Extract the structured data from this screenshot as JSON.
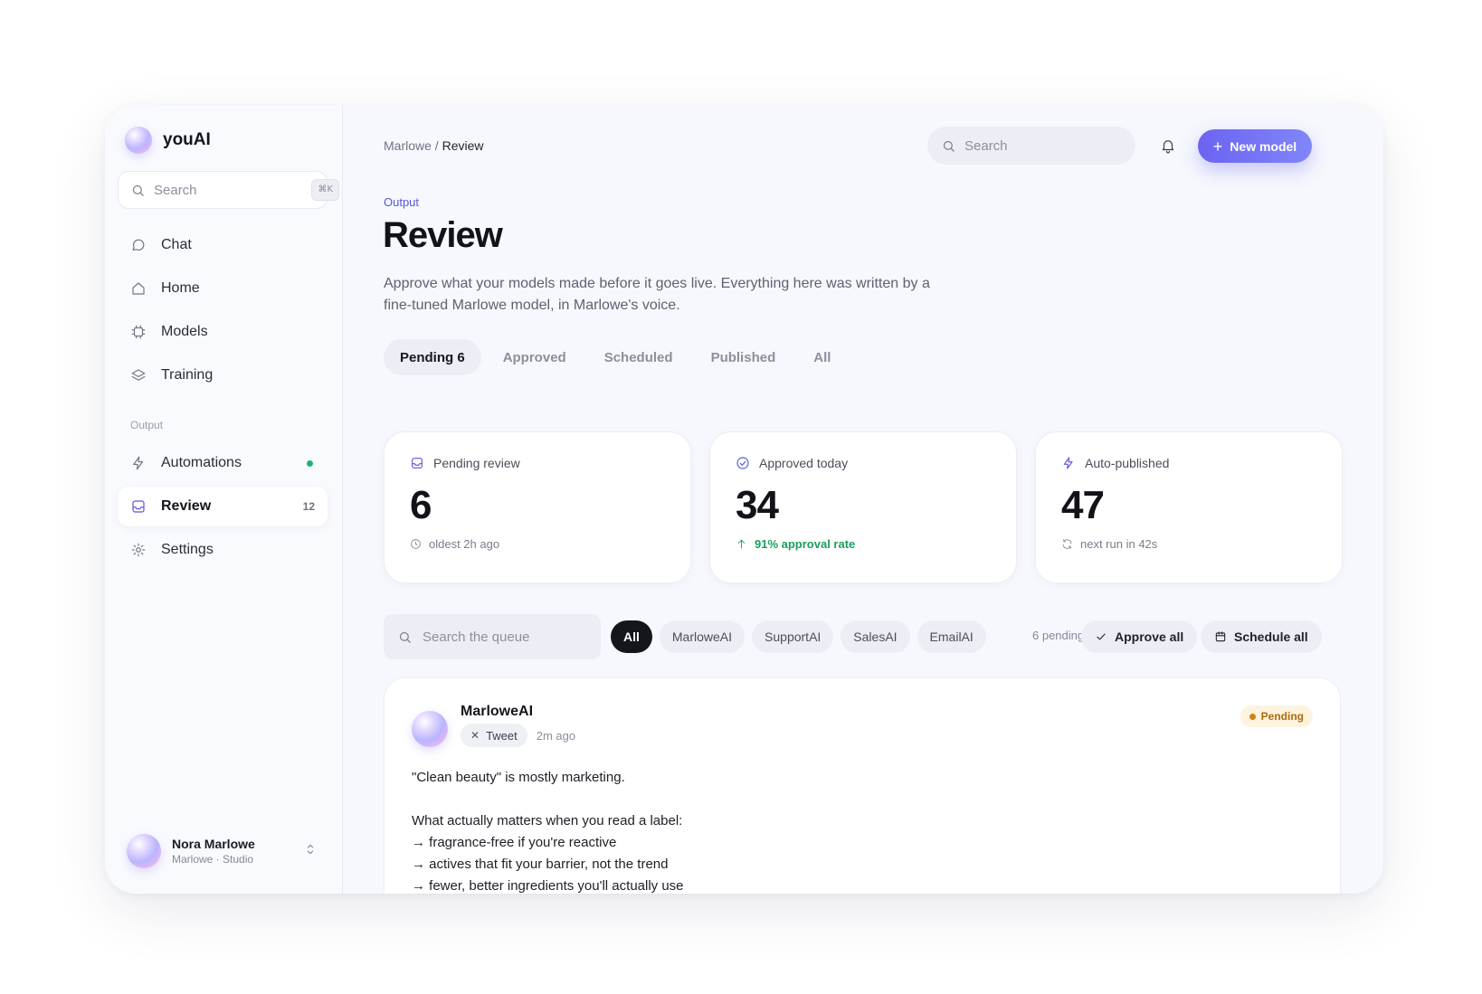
{
  "brand": {
    "name": "youAI"
  },
  "sidebar": {
    "search_placeholder": "Search",
    "shortcut": "⌘K",
    "items": [
      {
        "label": "Chat",
        "icon": "chat-bubble-icon"
      },
      {
        "label": "Home",
        "icon": "home-icon"
      },
      {
        "label": "Models",
        "icon": "chip-icon"
      },
      {
        "label": "Training",
        "icon": "layers-icon"
      }
    ],
    "section_label": "Output",
    "output_items": [
      {
        "label": "Automations",
        "icon": "bolt-icon",
        "status_color": "#1fb56f"
      },
      {
        "label": "Review",
        "icon": "inbox-icon",
        "badge": "12",
        "active": true
      },
      {
        "label": "Settings",
        "icon": "gear-icon"
      }
    ],
    "user": {
      "name": "Nora Marlowe",
      "subtitle": "Marlowe · Studio"
    }
  },
  "header": {
    "breadcrumb_parent": "Marlowe",
    "breadcrumb_sep": "/",
    "breadcrumb_current": "Review",
    "search_placeholder": "Search",
    "new_button_label": "New model"
  },
  "page": {
    "eyebrow": "Output",
    "title": "Review",
    "subtitle": "Approve what your models made before it goes live. Everything here was written by a fine-tuned Marlowe model, in Marlowe's voice.",
    "tabs": [
      {
        "label": "Pending 6",
        "active": true
      },
      {
        "label": "Approved"
      },
      {
        "label": "Scheduled"
      },
      {
        "label": "Published"
      },
      {
        "label": "All"
      }
    ]
  },
  "stats": [
    {
      "label": "Pending review",
      "value": "6",
      "foot": "oldest 2h ago",
      "icon": "inbox-icon",
      "foot_icon": "clock-icon"
    },
    {
      "label": "Approved today",
      "value": "34",
      "foot": "91% approval rate",
      "icon": "check-circle-icon",
      "foot_icon": "arrow-up-icon"
    },
    {
      "label": "Auto-published",
      "value": "47",
      "foot": "next run in 42s",
      "icon": "bolt-icon",
      "foot_icon": "refresh-icon"
    }
  ],
  "queue": {
    "search_placeholder": "Search the queue",
    "chips": [
      "All",
      "MarloweAI",
      "SupportAI",
      "SalesAI",
      "EmailAI"
    ],
    "pending_count": "6 pending",
    "approve_all_label": "Approve all",
    "schedule_all_label": "Schedule all"
  },
  "post": {
    "author": "MarloweAI",
    "type": "Tweet",
    "time": "2m ago",
    "status": "Pending",
    "body": "\"Clean beauty\" is mostly marketing.\n\nWhat actually matters when you read a label:\n→ fragrance-free if you're reactive\n→ actives that fit your barrier, not the trend\n→ fewer, better ingredients you'll actually use"
  },
  "colors": {
    "accent": "#6c63f2",
    "success": "#1a9e5d",
    "pending": "#b06a0a"
  }
}
